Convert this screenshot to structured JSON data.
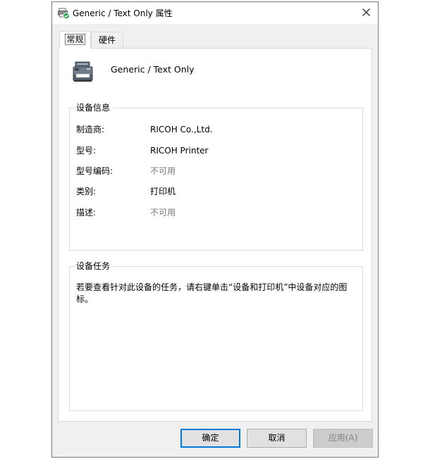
{
  "window": {
    "title": "Generic / Text Only 属性"
  },
  "tabs": [
    {
      "label": "常规",
      "active": true
    },
    {
      "label": "硬件",
      "active": false
    }
  ],
  "device": {
    "name": "Generic / Text Only"
  },
  "device_info": {
    "legend": "设备信息",
    "rows": [
      {
        "label": "制造商:",
        "value": "RICOH Co.,Ltd."
      },
      {
        "label": "型号:",
        "value": "RICOH Printer"
      },
      {
        "label": "型号编码:",
        "value": "不可用"
      },
      {
        "label": "类别:",
        "value": "打印机"
      },
      {
        "label": "描述:",
        "value": "不可用"
      }
    ]
  },
  "device_tasks": {
    "legend": "设备任务",
    "text": "若要查看针对此设备的任务，请右键单击“设备和打印机”中设备对应的图标。"
  },
  "buttons": {
    "ok": "确定",
    "cancel": "取消",
    "apply": "应用(A)"
  },
  "icons": {
    "title": "printer-default-icon",
    "close": "close-icon",
    "device": "multifunction-printer-icon"
  },
  "colors": {
    "accent": "#0078d7",
    "default_badge": "#21a645",
    "unavailable_text": "#7a7a7a"
  }
}
